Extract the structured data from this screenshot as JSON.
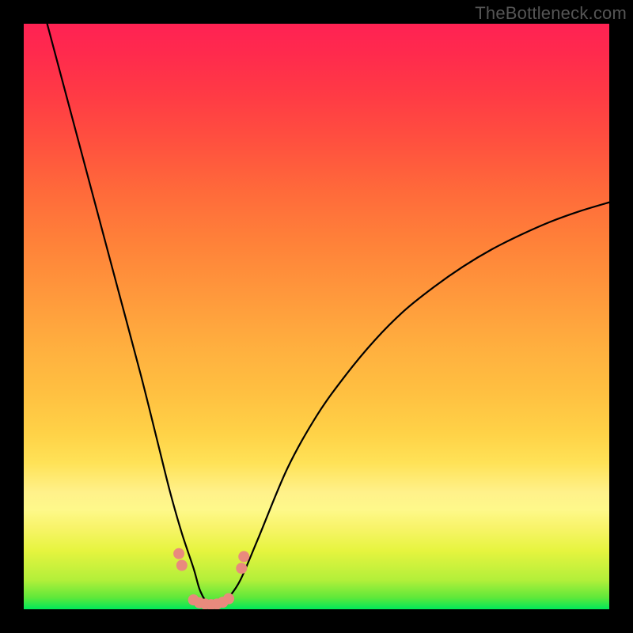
{
  "watermark": "TheBottleneck.com",
  "chart_data": {
    "type": "line",
    "title": "",
    "xlabel": "",
    "ylabel": "",
    "xlim": [
      0,
      100
    ],
    "ylim": [
      0,
      100
    ],
    "series": [
      {
        "name": "bottleneck-curve",
        "x": [
          4,
          8,
          12,
          16,
          20,
          23,
          25,
          27,
          29,
          30,
          31,
          32,
          33,
          34,
          35,
          37,
          40,
          45,
          50,
          55,
          60,
          65,
          70,
          75,
          80,
          85,
          90,
          95,
          100
        ],
        "values": [
          100,
          85,
          70,
          55,
          40,
          28,
          20,
          13,
          7,
          3.5,
          1.5,
          0.5,
          0.5,
          1,
          2,
          5,
          12,
          24,
          33,
          40,
          46,
          51,
          55,
          58.5,
          61.5,
          64,
          66.2,
          68,
          69.5
        ]
      }
    ],
    "markers": {
      "comment": "salmon dots near valley",
      "color": "#e98a7d",
      "points": [
        {
          "x": 26.5,
          "y": 9.5
        },
        {
          "x": 27.0,
          "y": 7.5
        },
        {
          "x": 29.0,
          "y": 1.6
        },
        {
          "x": 30.0,
          "y": 1.1
        },
        {
          "x": 31.0,
          "y": 0.9
        },
        {
          "x": 32.0,
          "y": 0.8
        },
        {
          "x": 33.0,
          "y": 0.9
        },
        {
          "x": 34.0,
          "y": 1.2
        },
        {
          "x": 35.0,
          "y": 1.8
        },
        {
          "x": 37.2,
          "y": 7.0
        },
        {
          "x": 37.6,
          "y": 9.0
        }
      ]
    },
    "gradient_colors": {
      "top": "#ff2253",
      "bottom": "#00e85a"
    }
  }
}
